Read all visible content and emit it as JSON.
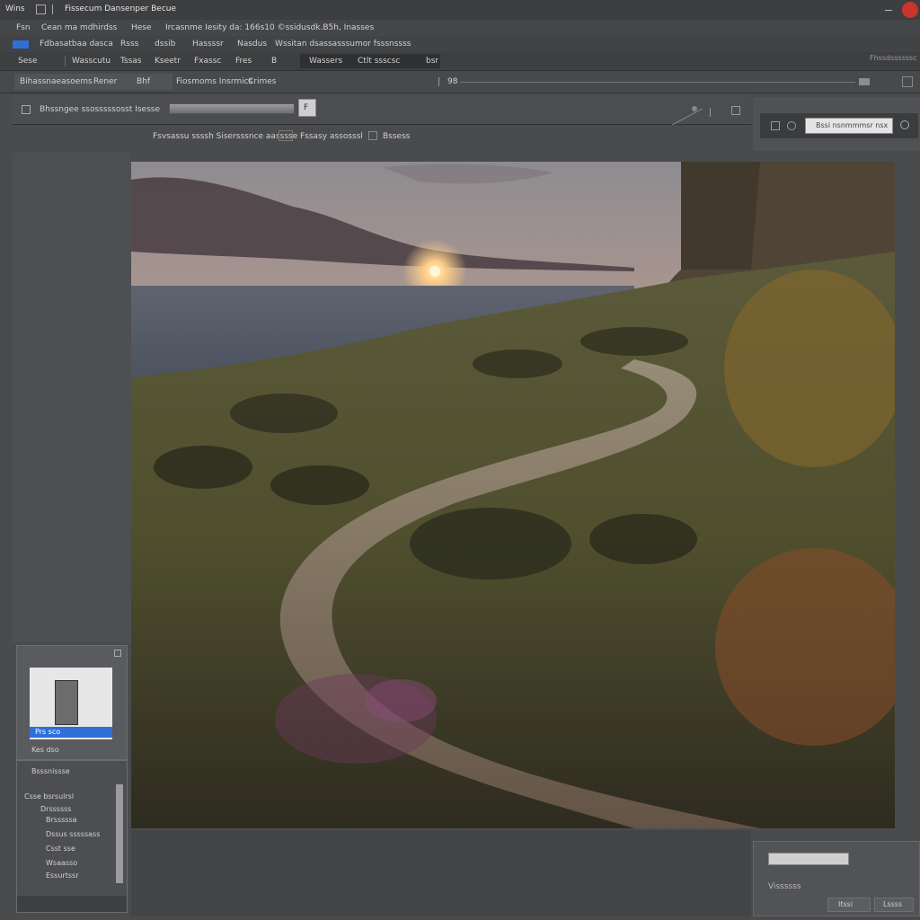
{
  "colors": {
    "titlebar": "#3d3e40",
    "panel": "#4a4b4d",
    "dark": "#363739",
    "accent": "#2f6fd8",
    "close": "#c8352b"
  },
  "titlebar": {
    "app_label": "Wins",
    "title": "Fissecum Dansenper Becue"
  },
  "menubar": {
    "items": [
      "Fsn",
      "Cean ma mdhirdss",
      "Hese",
      "Ircasnme Iesity da: 166s10 ©ssidusdk.B5h, Inasses"
    ]
  },
  "toolbar1": {
    "items": [
      "Fdbasatbaa dasca",
      "Rsss",
      "dssib",
      "Hassssr",
      "Nasdus",
      "Wssitan dsassasssumor fsssnssss"
    ]
  },
  "toolbar2": {
    "items": [
      "Sese",
      "Wasscutu",
      "Tssas",
      "Kseetr",
      "Fxassc",
      "Fres",
      "B",
      "Wassers",
      "Ctlt ssscsc",
      "bsr"
    ],
    "right_label": "Fhssdssssssc"
  },
  "optionsbar": {
    "items": [
      "Bihassnaeasoems",
      "Rener",
      "Bhf",
      "Fiosmoms Insrmics",
      "Crimes"
    ],
    "zoom_value": "98"
  },
  "searchrow": {
    "label": "Bhssngee ssosssssosst Isesse",
    "button": "F"
  },
  "inforow": {
    "text1": "Fsvsassu ssssh Sisersssnce aasssse",
    "text2": "Fssasy assosssl",
    "text3": "Bssess"
  },
  "right_panel": {
    "search_value": "Bssi nsnmmmsr nsx"
  },
  "left_panel": {
    "thumb_label": "Prs sco",
    "thumb_info": "Kes dso",
    "section_title": "Bsssnissse",
    "layers": [
      "Csse bsrsulrsl",
      "Drssssss",
      "Brsssssa",
      "Dssus sssssass",
      "Csst sse",
      "Wsaasso",
      "Essurtssr"
    ]
  },
  "bottom_right": {
    "field_label": "Vissssss",
    "button1": "Itssi",
    "button2": "Lssss"
  }
}
